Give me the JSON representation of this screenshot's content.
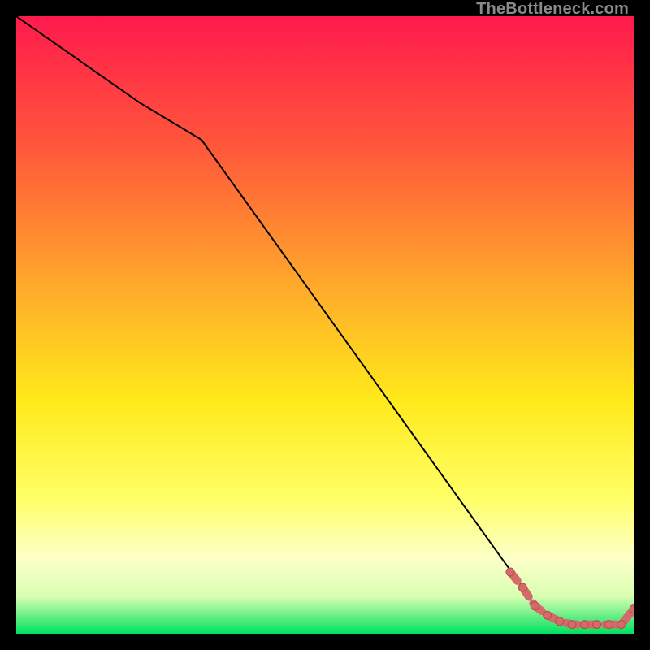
{
  "watermark": "TheBottleneck.com",
  "colors": {
    "bg": "#000000",
    "grad_top": "#ff1a4d",
    "grad_mid1": "#ff7a2a",
    "grad_mid2": "#ffd500",
    "grad_mid3": "#ffff4d",
    "grad_mid4": "#fbffb0",
    "grad_bottom": "#00e060",
    "line_main": "#000000",
    "dot": "#d46a6a",
    "dot_stroke": "#b84a4a"
  },
  "chart_data": {
    "type": "line",
    "title": "",
    "xlabel": "",
    "ylabel": "",
    "xlim": [
      0,
      100
    ],
    "ylim": [
      0,
      100
    ],
    "grid": false,
    "series": [
      {
        "name": "main-curve",
        "x": [
          0,
          10,
          20,
          30,
          82,
          84,
          86,
          88,
          90,
          92,
          94,
          96,
          98,
          100
        ],
        "y": [
          100,
          93,
          86,
          80,
          7.5,
          4.5,
          3,
          2,
          1.5,
          1.5,
          1.5,
          1.5,
          1.5,
          4
        ]
      }
    ],
    "highlight_segment": {
      "comment": "thick salmon dotted segment near bottom-right",
      "x": [
        80,
        82,
        84,
        86,
        88,
        90,
        92,
        94,
        96,
        98,
        100
      ],
      "y": [
        10,
        7.5,
        4.5,
        3,
        2,
        1.5,
        1.5,
        1.5,
        1.5,
        1.5,
        4
      ]
    }
  }
}
